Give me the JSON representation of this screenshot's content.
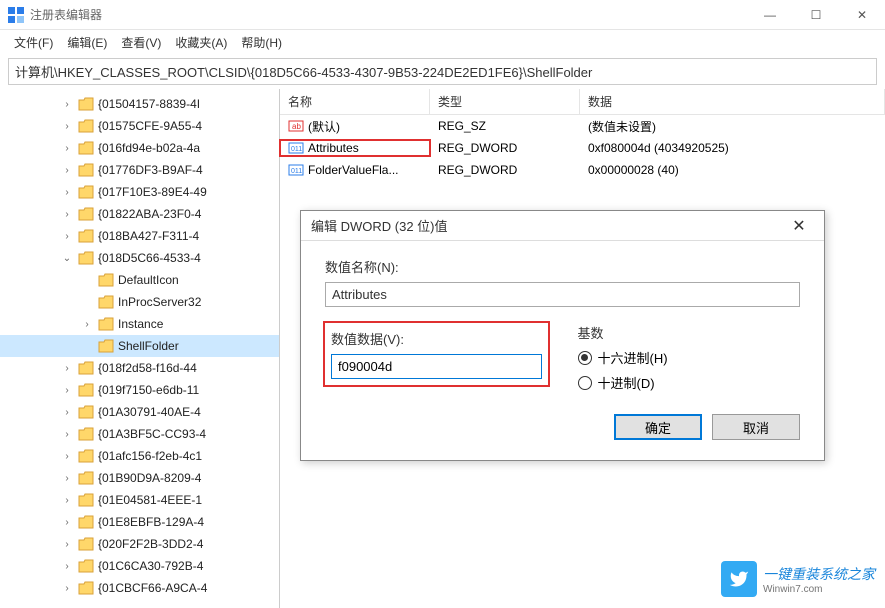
{
  "window": {
    "title": "注册表编辑器",
    "controls": {
      "min": "—",
      "max": "☐",
      "close": "✕"
    }
  },
  "menu": {
    "file": "文件(F)",
    "edit": "编辑(E)",
    "view": "查看(V)",
    "favorites": "收藏夹(A)",
    "help": "帮助(H)"
  },
  "address": "计算机\\HKEY_CLASSES_ROOT\\CLSID\\{018D5C66-4533-4307-9B53-224DE2ED1FE6}\\ShellFolder",
  "tree": {
    "items": [
      {
        "depth": 1,
        "exp": "›",
        "label": "{01504157-8839-4I"
      },
      {
        "depth": 1,
        "exp": "›",
        "label": "{01575CFE-9A55-4"
      },
      {
        "depth": 1,
        "exp": "›",
        "label": "{016fd94e-b02a-4a"
      },
      {
        "depth": 1,
        "exp": "›",
        "label": "{01776DF3-B9AF-4"
      },
      {
        "depth": 1,
        "exp": "›",
        "label": "{017F10E3-89E4-49"
      },
      {
        "depth": 1,
        "exp": "›",
        "label": "{01822ABA-23F0-4"
      },
      {
        "depth": 1,
        "exp": "›",
        "label": "{018BA427-F311-4"
      },
      {
        "depth": 1,
        "exp": "⌄",
        "label": "{018D5C66-4533-4"
      },
      {
        "depth": 2,
        "exp": "",
        "label": "DefaultIcon"
      },
      {
        "depth": 2,
        "exp": "",
        "label": "InProcServer32"
      },
      {
        "depth": 2,
        "exp": "›",
        "label": "Instance"
      },
      {
        "depth": 2,
        "exp": "",
        "label": "ShellFolder",
        "selected": true
      },
      {
        "depth": 1,
        "exp": "›",
        "label": "{018f2d58-f16d-44"
      },
      {
        "depth": 1,
        "exp": "›",
        "label": "{019f7150-e6db-11"
      },
      {
        "depth": 1,
        "exp": "›",
        "label": "{01A30791-40AE-4"
      },
      {
        "depth": 1,
        "exp": "›",
        "label": "{01A3BF5C-CC93-4"
      },
      {
        "depth": 1,
        "exp": "›",
        "label": "{01afc156-f2eb-4c1"
      },
      {
        "depth": 1,
        "exp": "›",
        "label": "{01B90D9A-8209-4"
      },
      {
        "depth": 1,
        "exp": "›",
        "label": "{01E04581-4EEE-1"
      },
      {
        "depth": 1,
        "exp": "›",
        "label": "{01E8EBFB-129A-4"
      },
      {
        "depth": 1,
        "exp": "›",
        "label": "{020F2F2B-3DD2-4"
      },
      {
        "depth": 1,
        "exp": "›",
        "label": "{01C6CA30-792B-4"
      },
      {
        "depth": 1,
        "exp": "›",
        "label": "{01CBCF66-A9CA-4"
      }
    ]
  },
  "list": {
    "headers": {
      "name": "名称",
      "type": "类型",
      "data": "数据"
    },
    "rows": [
      {
        "icon": "string",
        "name": "(默认)",
        "type": "REG_SZ",
        "data": "(数值未设置)"
      },
      {
        "icon": "dword",
        "name": "Attributes",
        "type": "REG_DWORD",
        "data": "0xf080004d (4034920525)",
        "hi": true
      },
      {
        "icon": "dword",
        "name": "FolderValueFla...",
        "type": "REG_DWORD",
        "data": "0x00000028 (40)"
      }
    ]
  },
  "dialog": {
    "title": "编辑 DWORD (32 位)值",
    "name_label": "数值名称(N):",
    "name_value": "Attributes",
    "data_label": "数值数据(V):",
    "data_value": "f090004d",
    "radix_label": "基数",
    "hex_label": "十六进制(H)",
    "dec_label": "十进制(D)",
    "ok": "确定",
    "cancel": "取消"
  },
  "watermark": {
    "text": "一键重装系统之家",
    "sub": "Winwin7.com"
  }
}
